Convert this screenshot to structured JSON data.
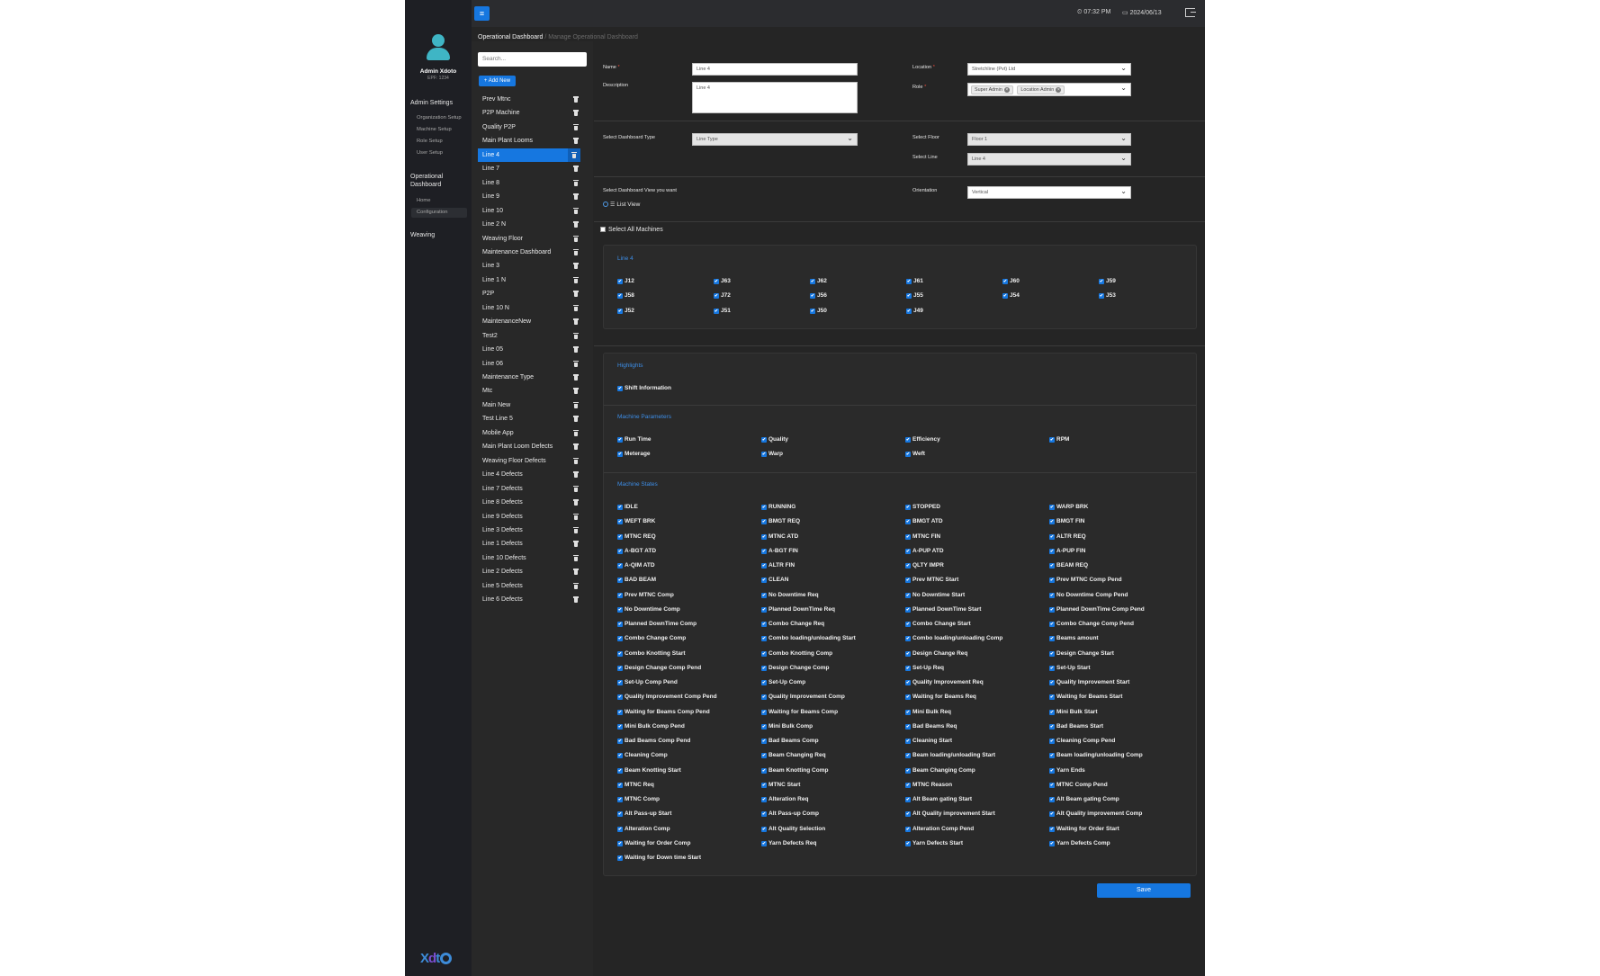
{
  "header": {
    "time": "07:32 PM",
    "date": "2024/06/13"
  },
  "user": {
    "name": "Admin Xdoto",
    "sub": "EPF: 1234"
  },
  "sidebar": {
    "admin_settings": "Admin Settings",
    "admin_items": [
      "Organization Setup",
      "Machine Setup",
      "Role Setup",
      "User Setup"
    ],
    "operational_line1": "Operational",
    "operational_line2": "Dashboard",
    "operational_items": [
      "Home",
      "Configuration"
    ],
    "weaving": "Weaving"
  },
  "breadcrumb": {
    "current": "Operational Dashboard",
    "sep": "/",
    "page": "Manage Operational Dashboard"
  },
  "list": {
    "search_placeholder": "Search...",
    "add_new": "+ Add New",
    "items": [
      "Prev Mtnc",
      "P2P Machine",
      "Quality P2P",
      "Main Plant Looms",
      "Line 4",
      "Line 7",
      "Line 8",
      "Line 9",
      "Line 10",
      "Line 2 N",
      "Weaving Floor",
      "Maintenance Dashboard",
      "Line 3",
      "Line 1 N",
      "P2P",
      "Line 10 N",
      "MaintenanceNew",
      "Test2",
      "Line 05",
      "Line 06",
      "Maintenance Type",
      "Mtc",
      "Main New",
      "Test Line 5",
      "Mobile App",
      "Main Plant Loom Defects",
      "Weaving Floor Defects",
      "Line 4 Defects",
      "Line 7 Defects",
      "Line 8 Defects",
      "Line 9 Defects",
      "Line 3 Defects",
      "Line 1 Defects",
      "Line 10 Defects",
      "Line 2 Defects",
      "Line 5 Defects",
      "Line 6 Defects"
    ],
    "selected": "Line 4"
  },
  "form": {
    "name_label": "Name",
    "name_value": "Line 4",
    "desc_label": "Description",
    "desc_value": "Line 4",
    "location_label": "Location",
    "location_value": "Stretchline (Pvt) Ltd",
    "role_label": "Role",
    "roles": [
      "Super Admin",
      "Location Admin"
    ],
    "type_label": "Select Dashboard Type",
    "type_value": "Line Type",
    "floor_label": "Select Floor",
    "floor_value": "Floor 1",
    "line_label": "Select Line",
    "line_value": "Line 4",
    "view_label": "Select Dashboard View you want",
    "view_value": "List View",
    "orientation_label": "Orientation",
    "orientation_value": "Vertical"
  },
  "machines": {
    "select_all": "Select All Machines",
    "line_title": "Line 4",
    "items": [
      "J12",
      "J63",
      "J62",
      "J61",
      "J60",
      "J59",
      "J58",
      "J72",
      "J56",
      "J55",
      "J54",
      "J53",
      "J52",
      "J51",
      "J50",
      "J49"
    ]
  },
  "highlights": {
    "title": "Highlights",
    "items": [
      "Shift Information"
    ]
  },
  "machine_parameters": {
    "title": "Machine Parameters",
    "items": [
      "Run Time",
      "Quality",
      "Efficiency",
      "RPM",
      "Meterage",
      "Warp",
      "Weft"
    ]
  },
  "machine_states": {
    "title": "Machine States",
    "items": [
      "IDLE",
      "RUNNING",
      "STOPPED",
      "WARP BRK",
      "WEFT BRK",
      "BMGT REQ",
      "BMGT ATD",
      "BMGT FIN",
      "MTNC REQ",
      "MTNC ATD",
      "MTNC FIN",
      "ALTR REQ",
      "A-BGT ATD",
      "A-BGT FIN",
      "A-PUP ATD",
      "A-PUP FIN",
      "A-QIM ATD",
      "ALTR FIN",
      "QLTY IMPR",
      "BEAM REQ",
      "BAD BEAM",
      "CLEAN",
      "Prev MTNC Start",
      "Prev MTNC Comp Pend",
      "Prev MTNC Comp",
      "No Downtime Req",
      "No Downtime Start",
      "No Downtime Comp Pend",
      "No Downtime Comp",
      "Planned DownTime Req",
      "Planned DownTime Start",
      "Planned DownTime Comp Pend",
      "Planned DownTime Comp",
      "Combo Change Req",
      "Combo Change Start",
      "Combo Change Comp Pend",
      "Combo Change Comp",
      "Combo loading/unloading Start",
      "Combo loading/unloading Comp",
      "Beams amount",
      "Combo Knotting Start",
      "Combo Knotting Comp",
      "Design Change Req",
      "Design Change Start",
      "Design Change Comp Pend",
      "Design Change Comp",
      "Set-Up Req",
      "Set-Up Start",
      "Set-Up Comp Pend",
      "Set-Up Comp",
      "Quality Improvement Req",
      "Quality Improvement Start",
      "Quality Improvement Comp Pend",
      "Quality Improvement Comp",
      "Waiting for Beams Req",
      "Waiting for Beams Start",
      "Waiting for Beams Comp Pend",
      "Waiting for Beams Comp",
      "Mini Bulk Req",
      "Mini Bulk Start",
      "Mini Bulk Comp Pend",
      "Mini Bulk Comp",
      "Bad Beams Req",
      "Bad Beams Start",
      "Bad Beams Comp Pend",
      "Bad Beams Comp",
      "Cleaning Start",
      "Cleaning Comp Pend",
      "Cleaning Comp",
      "Beam Changing Req",
      "Beam loading/unloading Start",
      "Beam loading/unloading Comp",
      "Beam Knotting Start",
      "Beam Knotting Comp",
      "Beam Changing Comp",
      "Yarn Ends",
      "MTNC Req",
      "MTNC Start",
      "MTNC Reason",
      "MTNC Comp Pend",
      "MTNC Comp",
      "Alteration Req",
      "Alt Beam gating Start",
      "Alt Beam gating Comp",
      "Alt Pass-up Start",
      "Alt Pass-up Comp",
      "Alt Quality improvement Start",
      "Alt Quality improvement Comp",
      "Alteration Comp",
      "Alt Quality Selection",
      "Alteration Comp Pend",
      "Waiting for Order Start",
      "Waiting for Order Comp",
      "Yarn Defects Req",
      "Yarn Defects Start",
      "Yarn Defects Comp",
      "Waiting for Down time Start"
    ]
  },
  "save_label": "Save",
  "colors": {
    "accent": "#1677e0",
    "background": "#252525",
    "nav": "#1e1f24",
    "section_title": "#3d8ee8"
  }
}
